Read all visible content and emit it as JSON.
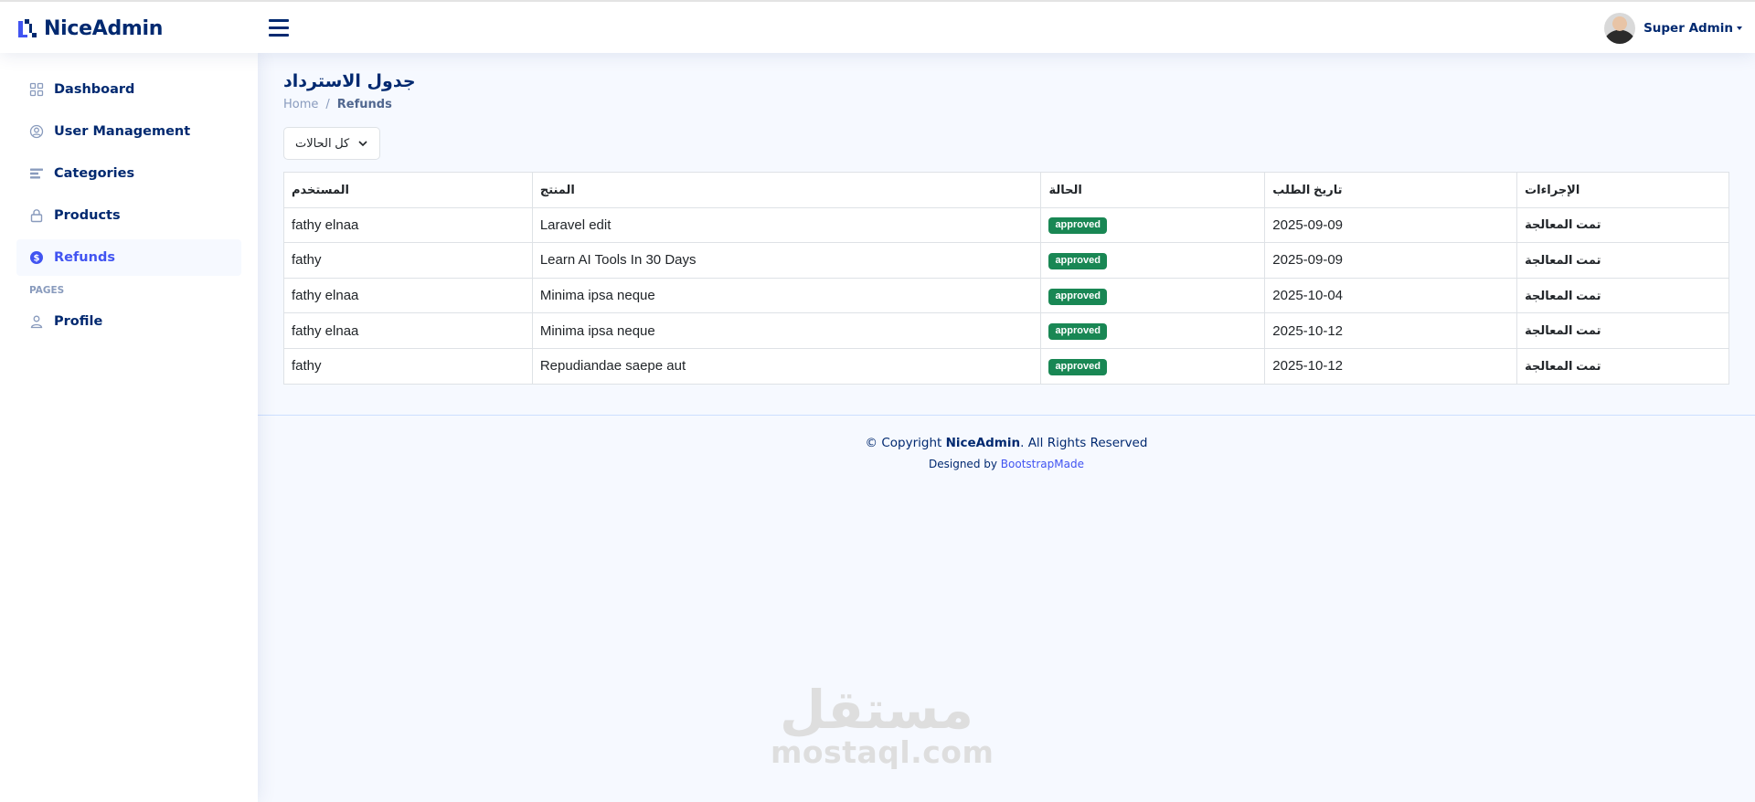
{
  "header": {
    "logo_text": "NiceAdmin",
    "profile_name": "Super Admin"
  },
  "sidebar": {
    "items": [
      {
        "label": "Dashboard",
        "icon": "grid-icon"
      },
      {
        "label": "User Management",
        "icon": "user-circle-icon"
      },
      {
        "label": "Categories",
        "icon": "list-icon"
      },
      {
        "label": "Products",
        "icon": "lock-icon"
      },
      {
        "label": "Refunds",
        "icon": "dollar-circle-icon",
        "active": true
      }
    ],
    "pages_heading": "PAGES",
    "pages_items": [
      {
        "label": "Profile",
        "icon": "person-icon"
      }
    ]
  },
  "main": {
    "title": "جدول الاسترداد",
    "breadcrumb": {
      "home": "Home",
      "separator": "/",
      "current": "Refunds"
    },
    "filter": {
      "selected": "كل الحالات"
    },
    "table": {
      "headers": [
        "المستخدم",
        "المنتج",
        "الحالة",
        "تاريخ الطلب",
        "الإجراءات"
      ],
      "rows": [
        {
          "user": "fathy elnaa",
          "product": "Laravel edit",
          "status": "approved",
          "date": "2025-09-09",
          "action": "تمت المعالجة"
        },
        {
          "user": "fathy",
          "product": "Learn AI Tools In 30 Days",
          "status": "approved",
          "date": "2025-09-09",
          "action": "تمت المعالجة"
        },
        {
          "user": "fathy elnaa",
          "product": "Minima ipsa neque",
          "status": "approved",
          "date": "2025-10-04",
          "action": "تمت المعالجة"
        },
        {
          "user": "fathy elnaa",
          "product": "Minima ipsa neque",
          "status": "approved",
          "date": "2025-10-12",
          "action": "تمت المعالجة"
        },
        {
          "user": "fathy",
          "product": "Repudiandae saepe aut",
          "status": "approved",
          "date": "2025-10-12",
          "action": "تمت المعالجة"
        }
      ]
    }
  },
  "footer": {
    "copyright_prefix": "© Copyright ",
    "brand": "NiceAdmin",
    "copyright_suffix": ". All Rights Reserved",
    "designed_by": "Designed by ",
    "designer": "BootstrapMade"
  },
  "watermark": {
    "arabic": "مستقل",
    "domain": "mostaql.com"
  },
  "colors": {
    "brand": "#012970",
    "accent": "#4154f1",
    "badge_approved": "#198754",
    "background": "#f6f9ff"
  }
}
